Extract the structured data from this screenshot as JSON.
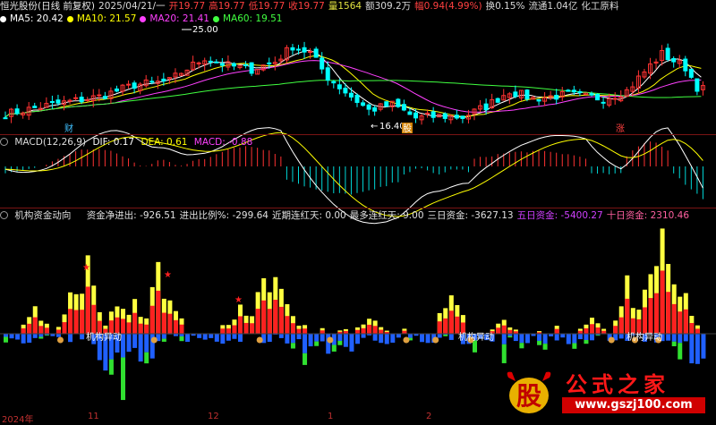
{
  "main": {
    "title": "恒光股份(日线 前复权)",
    "items": [
      {
        "text": "2025/04/21/一",
        "color": "#d8d8d8"
      },
      {
        "text": "开19.77",
        "color": "#ff4040"
      },
      {
        "text": "高19.77",
        "color": "#ff4040"
      },
      {
        "text": "低19.77",
        "color": "#ff4040"
      },
      {
        "text": "收19.77",
        "color": "#ff4040"
      },
      {
        "text": "量1564",
        "color": "#e0e040"
      },
      {
        "text": "额309.2万",
        "color": "#d8d8d8"
      },
      {
        "text": "幅0.94(4.99%)",
        "color": "#ff4040"
      },
      {
        "text": "换0.15%",
        "color": "#d8d8d8"
      },
      {
        "text": "流通1.04亿",
        "color": "#d8d8d8"
      },
      {
        "text": "化工原料",
        "color": "#d8d8d8"
      }
    ],
    "ma": [
      {
        "label": "MA5: 20.42",
        "color": "#ffffff"
      },
      {
        "label": "MA10: 21.57",
        "color": "#ffff00"
      },
      {
        "label": "MA20: 21.41",
        "color": "#ff40ff"
      },
      {
        "label": "MA60: 19.51",
        "color": "#40ff40"
      }
    ],
    "high_label": "25.00",
    "low_label": "16.40",
    "mark_cai": "财",
    "mark_zhang": "涨",
    "mark_pai": "股",
    "arrow_glyph": "←"
  },
  "macd": {
    "title": "MACD(12,26,9)",
    "dif": "DIF: 0.17",
    "dea": "DEA: 0.61",
    "macd": "MACD: -0.88"
  },
  "fund": {
    "title": "机构资金动向",
    "items": [
      {
        "text": "资金净进出: -926.51",
        "color": "#e0e0e0"
      },
      {
        "text": "进出比例%: -299.64",
        "color": "#e0e0e0"
      },
      {
        "text": "近期连红天: 0.00",
        "color": "#e0e0e0"
      },
      {
        "text": "最多连红天: 9.00",
        "color": "#e0e0e0"
      },
      {
        "text": "三日资金: -3627.13",
        "color": "#e0e0e0"
      },
      {
        "text": "五日资金: -5400.27",
        "color": "#d040ff"
      },
      {
        "text": "十日资金: 2310.46",
        "color": "#ff60a0"
      }
    ],
    "buy_label": "机构异动",
    "star": "★"
  },
  "xaxis": [
    "2024年",
    "11",
    "12",
    "1",
    "2"
  ],
  "watermark": {
    "logo_text": "股",
    "name": "公式之家",
    "url": "www.gszj100.com"
  },
  "colors": {
    "up": "#ff3232",
    "down": "#00ffff",
    "accent": "#c00000"
  }
}
